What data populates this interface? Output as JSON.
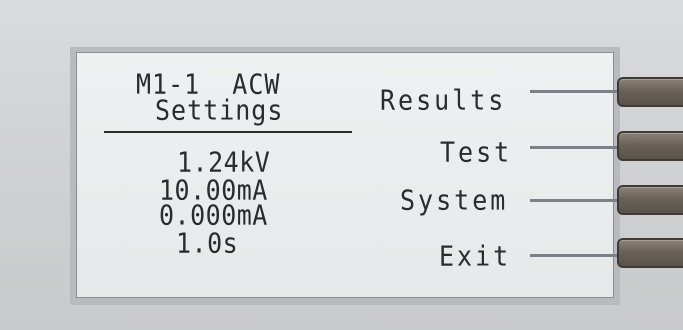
{
  "screen": {
    "title_line1": "M1-1  ACW",
    "title_line2": "Settings",
    "values": [
      "1.24kV",
      "10.00mA",
      "0.000mA",
      "1.0s"
    ]
  },
  "softkeys": [
    {
      "label": "Results"
    },
    {
      "label": "Test"
    },
    {
      "label": "System"
    },
    {
      "label": "Exit"
    }
  ]
}
